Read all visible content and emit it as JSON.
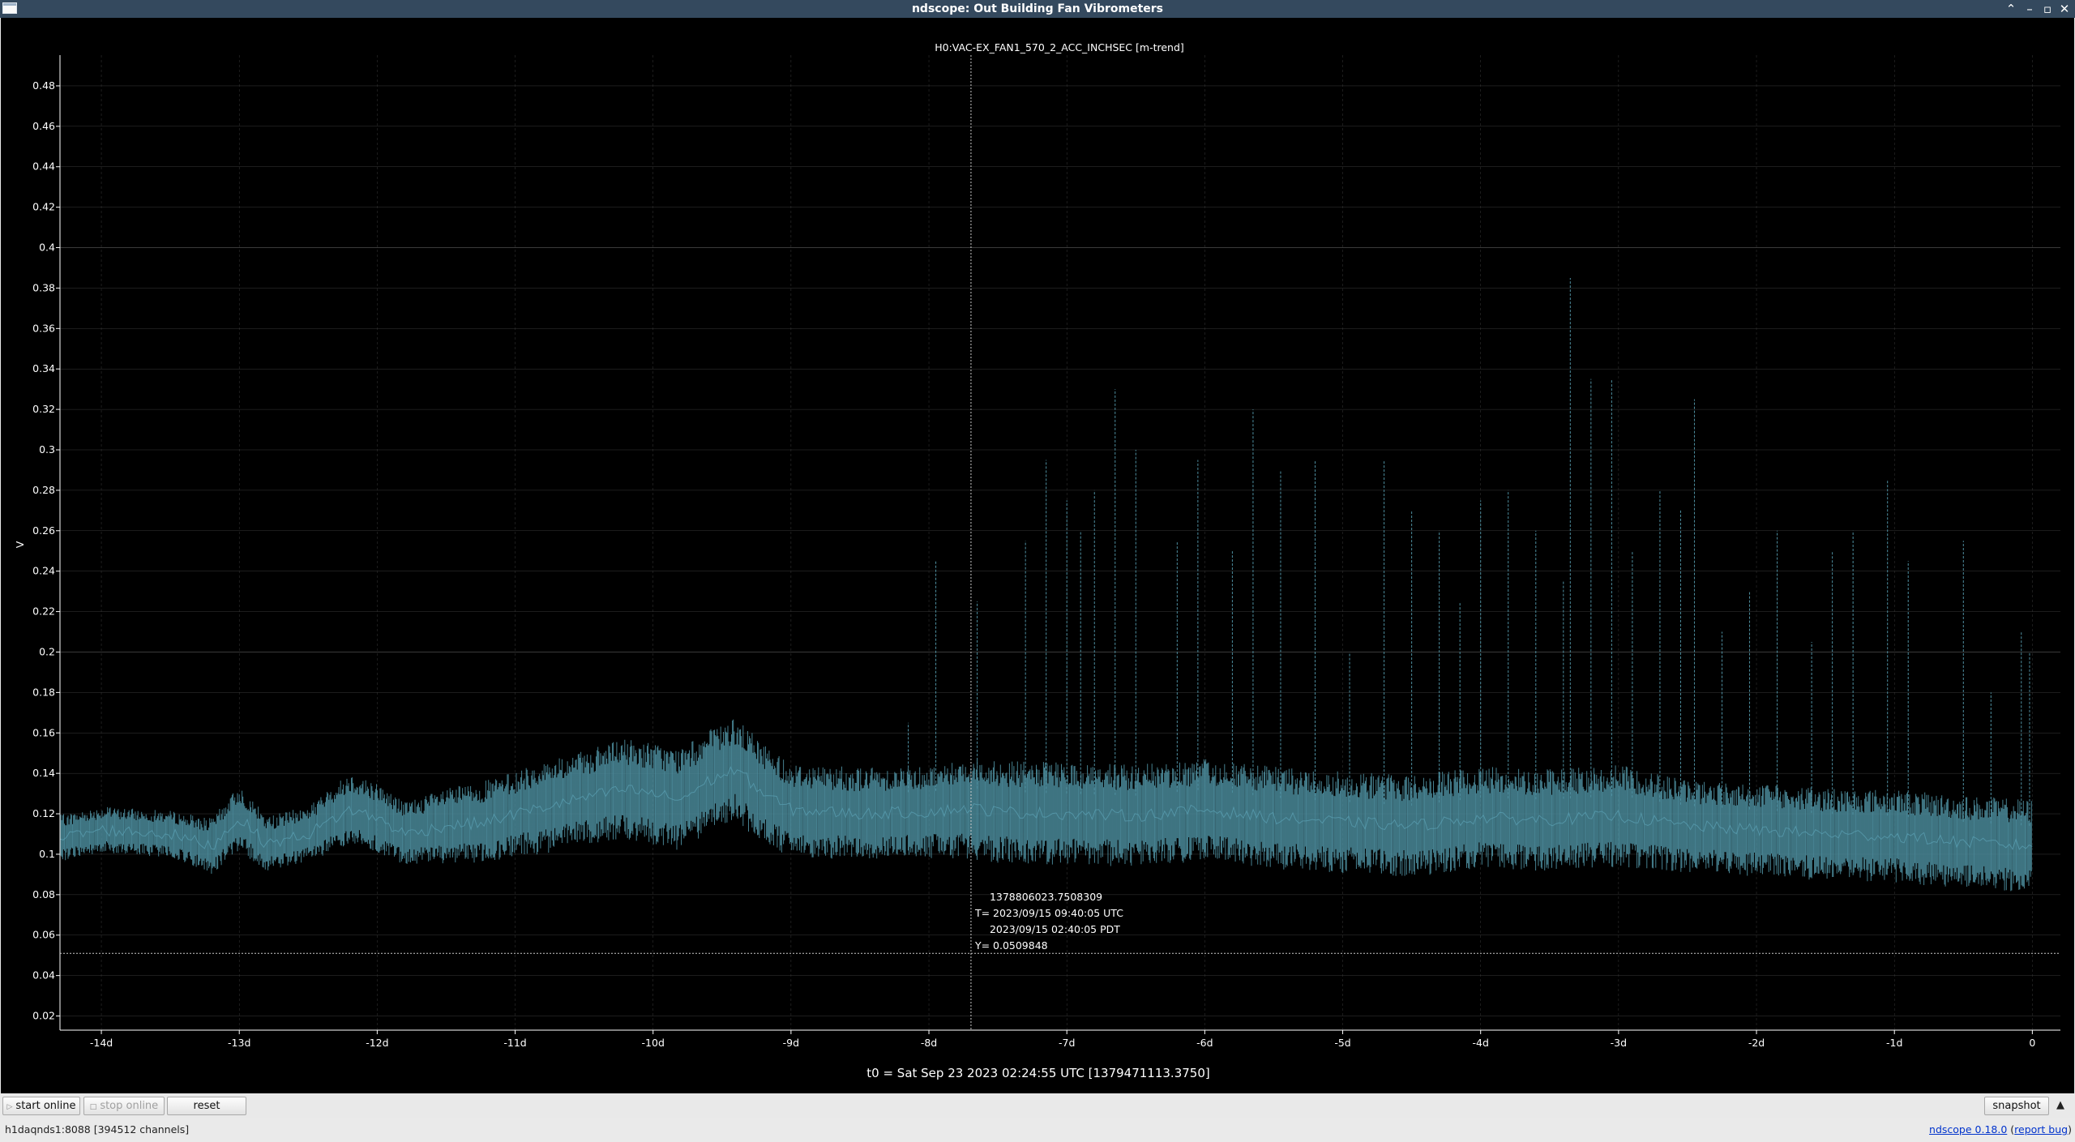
{
  "window": {
    "title": "ndscope: Out Building Fan Vibrometers",
    "controls": {
      "shade": "⌃",
      "minimize": "–",
      "maximize": "▫",
      "close": "✕"
    }
  },
  "plot": {
    "channel_title": "H0:VAC-EX_FAN1_570_2_ACC_INCHSEC [m-trend]",
    "t0_label": "t0 = Sat Sep 23 2023 02:24:55 UTC [1379471113.3750]",
    "cursor": {
      "gps": "1378806023.7508309",
      "utc": "T= 2023/09/15 09:40:05 UTC",
      "pdt": "2023/09/15 02:40:05 PDT",
      "y": "Y= 0.0509848",
      "x_days": -7.695,
      "y_value": 0.0509848
    },
    "colors": {
      "trace": "#4e8fa0",
      "background": "#000000",
      "axis": "#ffffff",
      "grid": "#3a3a3a"
    }
  },
  "chart_data": {
    "type": "line",
    "xlabel": "",
    "ylabel": "V",
    "xlim": [
      -14.3,
      0.18
    ],
    "ylim": [
      0.013,
      0.492
    ],
    "x_ticks": [
      -14,
      -13,
      -12,
      -11,
      -10,
      -9,
      -8,
      -7,
      -6,
      -5,
      -4,
      -3,
      -2,
      -1,
      0
    ],
    "x_tick_labels": [
      "-14d",
      "-13d",
      "-12d",
      "-11d",
      "-10d",
      "-9d",
      "-8d",
      "-7d",
      "-6d",
      "-5d",
      "-4d",
      "-3d",
      "-2d",
      "-1d",
      "0"
    ],
    "y_ticks": [
      0.02,
      0.04,
      0.06,
      0.08,
      0.1,
      0.12,
      0.14,
      0.16,
      0.18,
      0.2,
      0.22,
      0.24,
      0.26,
      0.28,
      0.3,
      0.32,
      0.34,
      0.36,
      0.38,
      0.4,
      0.42,
      0.44,
      0.46,
      0.48
    ],
    "y_tick_labels": [
      "0.02",
      "0.04",
      "0.06",
      "0.08",
      "0.1",
      "0.12",
      "0.14",
      "0.16",
      "0.18",
      "0.2",
      "0.22",
      "0.24",
      "0.26",
      "0.28",
      "0.3",
      "0.32",
      "0.34",
      "0.36",
      "0.38",
      "0.4",
      "0.42",
      "0.44",
      "0.46",
      "0.48"
    ],
    "grid": true,
    "series": [
      {
        "x": [
          -14.3,
          -14.0,
          -13.5,
          -13.2,
          -13.0,
          -12.8,
          -12.5,
          -12.2,
          -12.0,
          -11.8,
          -11.5,
          -11.2,
          -11.0,
          -10.8,
          -10.5,
          -10.2,
          -10.0,
          -9.8,
          -9.6,
          -9.4,
          -9.2,
          -9.0,
          -8.5,
          -8.0,
          -7.7,
          -7.5,
          -7.0,
          -6.5,
          -6.0,
          -5.5,
          -5.0,
          -4.5,
          -4.0,
          -3.5,
          -3.0,
          -2.5,
          -2.0,
          -1.5,
          -1.0,
          -0.5,
          0.0
        ],
        "y": [
          0.108,
          0.112,
          0.11,
          0.104,
          0.118,
          0.105,
          0.11,
          0.122,
          0.118,
          0.11,
          0.114,
          0.116,
          0.12,
          0.123,
          0.128,
          0.132,
          0.13,
          0.127,
          0.136,
          0.142,
          0.13,
          0.122,
          0.12,
          0.121,
          0.123,
          0.121,
          0.12,
          0.119,
          0.122,
          0.118,
          0.116,
          0.114,
          0.118,
          0.117,
          0.119,
          0.114,
          0.112,
          0.11,
          0.109,
          0.106,
          0.104
        ],
        "band": [
          0.01,
          0.01,
          0.01,
          0.012,
          0.014,
          0.012,
          0.012,
          0.016,
          0.015,
          0.014,
          0.016,
          0.018,
          0.018,
          0.02,
          0.02,
          0.022,
          0.022,
          0.022,
          0.022,
          0.022,
          0.022,
          0.02,
          0.02,
          0.02,
          0.022,
          0.022,
          0.022,
          0.022,
          0.022,
          0.022,
          0.022,
          0.022,
          0.022,
          0.022,
          0.022,
          0.02,
          0.02,
          0.02,
          0.02,
          0.02,
          0.02
        ]
      }
    ],
    "spikes": [
      [
        -8.15,
        0.165
      ],
      [
        -7.95,
        0.245
      ],
      [
        -7.65,
        0.225
      ],
      [
        -7.3,
        0.255
      ],
      [
        -7.15,
        0.295
      ],
      [
        -7.0,
        0.275
      ],
      [
        -6.9,
        0.26
      ],
      [
        -6.8,
        0.28
      ],
      [
        -6.65,
        0.33
      ],
      [
        -6.5,
        0.3
      ],
      [
        -6.2,
        0.255
      ],
      [
        -6.05,
        0.295
      ],
      [
        -5.8,
        0.25
      ],
      [
        -5.65,
        0.32
      ],
      [
        -5.45,
        0.29
      ],
      [
        -5.2,
        0.295
      ],
      [
        -4.95,
        0.2
      ],
      [
        -4.7,
        0.295
      ],
      [
        -4.5,
        0.27
      ],
      [
        -4.3,
        0.26
      ],
      [
        -4.15,
        0.225
      ],
      [
        -4.0,
        0.275
      ],
      [
        -3.8,
        0.28
      ],
      [
        -3.6,
        0.26
      ],
      [
        -3.4,
        0.235
      ],
      [
        -3.35,
        0.385
      ],
      [
        -3.2,
        0.335
      ],
      [
        -3.05,
        0.335
      ],
      [
        -2.9,
        0.25
      ],
      [
        -2.7,
        0.28
      ],
      [
        -2.55,
        0.27
      ],
      [
        -2.45,
        0.325
      ],
      [
        -2.25,
        0.21
      ],
      [
        -2.05,
        0.23
      ],
      [
        -1.85,
        0.26
      ],
      [
        -1.6,
        0.205
      ],
      [
        -1.45,
        0.25
      ],
      [
        -1.3,
        0.26
      ],
      [
        -1.05,
        0.285
      ],
      [
        -0.9,
        0.245
      ],
      [
        -0.5,
        0.255
      ],
      [
        -0.3,
        0.18
      ],
      [
        -0.08,
        0.21
      ],
      [
        -0.02,
        0.2
      ]
    ]
  },
  "toolbar": {
    "start_online": "start online",
    "stop_online": "stop online",
    "reset": "reset",
    "snapshot": "snapshot",
    "expand_arrow": "▲"
  },
  "status": {
    "server": "h1daqnds1:8088  [394512 channels]",
    "version": "ndscope 0.18.0",
    "report": "report bug"
  }
}
